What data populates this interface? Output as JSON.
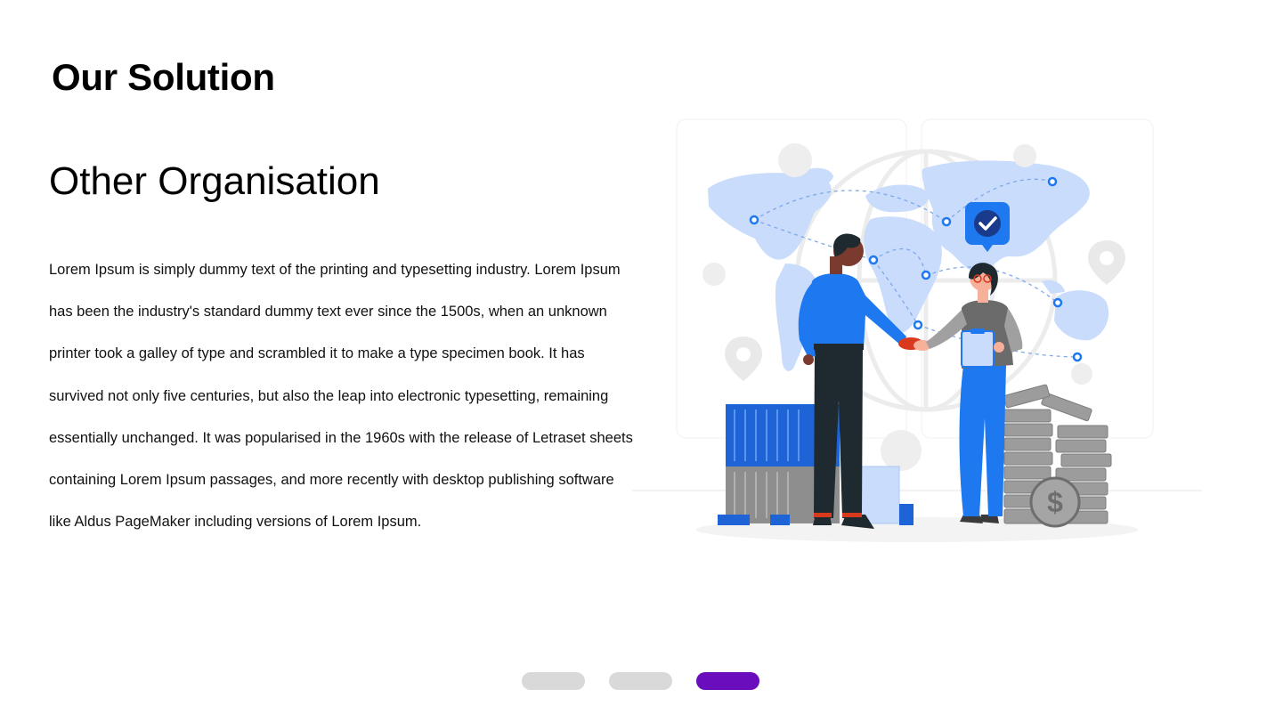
{
  "header": {
    "title": "Our Solution"
  },
  "section": {
    "title": "Other Organisation",
    "body": "Lorem Ipsum is simply dummy text of the printing and typesetting industry. Lorem Ipsum has been the industry's standard dummy text ever since the 1500s, when an unknown printer took a galley of type and scrambled it to make a type specimen book. It has survived not only five centuries, but also the leap into electronic typesetting, remaining essentially unchanged. It was popularised in the 1960s with the release of Letraset sheets containing Lorem Ipsum passages, and more recently with desktop publishing software like Aldus PageMaker including versions of Lorem Ipsum."
  },
  "illustration": {
    "subject": "business-handshake-world-map",
    "icons": [
      "check-badge-icon",
      "map-pin-icon",
      "dollar-coin-icon",
      "shipping-container-icon"
    ]
  },
  "pager": {
    "count": 3,
    "active_index": 2,
    "active_color": "#6a0dbd",
    "inactive_color": "#d9d9d9"
  },
  "colors": {
    "map_blue": "#c9dcfb",
    "accent_blue": "#1e78f0",
    "dark": "#1f2a30",
    "grey": "#8f8f8f"
  }
}
